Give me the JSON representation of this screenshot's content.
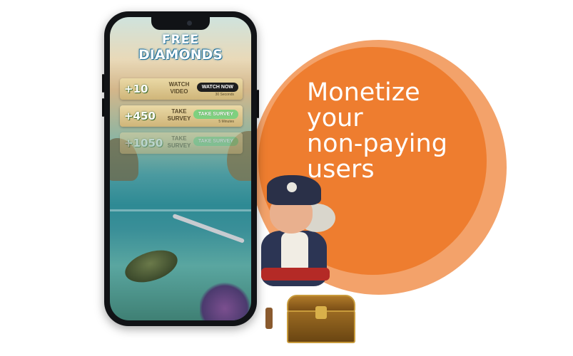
{
  "headline": {
    "lines": [
      "Monetize",
      "your",
      "non-paying",
      "users"
    ]
  },
  "app_screen": {
    "logo": {
      "line1": "FREE",
      "line2": "DIAMONDS"
    },
    "offers": [
      {
        "amount": "+10",
        "label": "WATCH VIDEO",
        "cta": "WATCH NOW",
        "sub": "30 Seconds",
        "cta_style": "dark"
      },
      {
        "amount": "+450",
        "label": "TAKE SURVEY",
        "cta": "TAKE SURVEY",
        "sub": "5 Minutes",
        "cta_style": "green"
      },
      {
        "amount": "+1050",
        "label": "TAKE SURVEY",
        "cta": "TAKE SURVEY",
        "sub": "",
        "cta_style": "green"
      }
    ]
  },
  "colors": {
    "accent_orange": "#ee7d2f",
    "accent_orange_light": "#f3a26a"
  },
  "icons": [
    "pirate-illustration",
    "treasure-chest-icon",
    "sea-turtle-icon"
  ]
}
